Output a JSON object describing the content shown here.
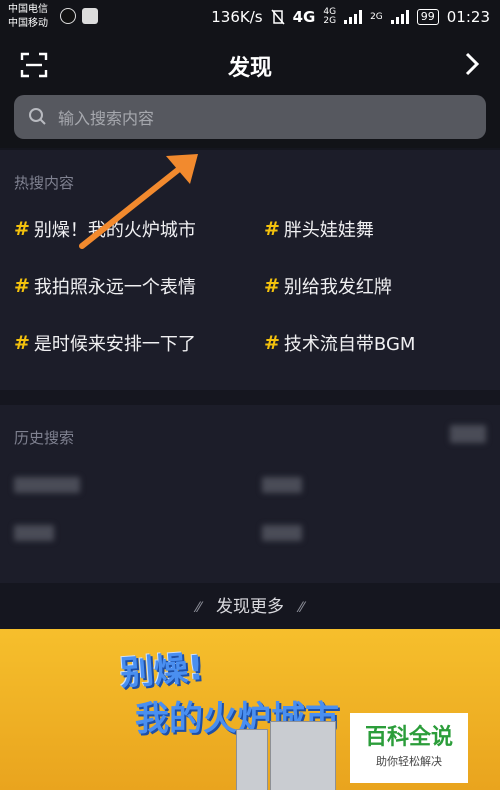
{
  "status_bar": {
    "carrier1": "中国电信",
    "carrier2": "中国移动",
    "speed": "136K/s",
    "network": "4G",
    "network_small_top": "4G",
    "network_small_bottom": "2G",
    "network_small_right": "2G",
    "battery": "99",
    "time": "01:23"
  },
  "header": {
    "title": "发现"
  },
  "search": {
    "placeholder": "输入搜索内容"
  },
  "hot": {
    "title": "热搜内容",
    "items": [
      {
        "label": "别燥！我的火炉城市"
      },
      {
        "label": "胖头娃娃舞"
      },
      {
        "label": "我拍照永远一个表情"
      },
      {
        "label": "别给我发红牌"
      },
      {
        "label": "是时候来安排一下了"
      },
      {
        "label": "技术流自带BGM"
      }
    ],
    "hash_symbol": "#",
    "hash_color": "#f4c20d"
  },
  "history": {
    "title": "历史搜索"
  },
  "more": {
    "label": "发现更多"
  },
  "banner": {
    "line1": "别燥!",
    "line2": "我的火炉城市",
    "watermark_big": "百科全说",
    "watermark_small": "助你轻松解决"
  },
  "colors": {
    "background": "#15161f",
    "panel": "#1c1d29",
    "accent": "#f4c20d",
    "arrow": "#f28a2e"
  }
}
